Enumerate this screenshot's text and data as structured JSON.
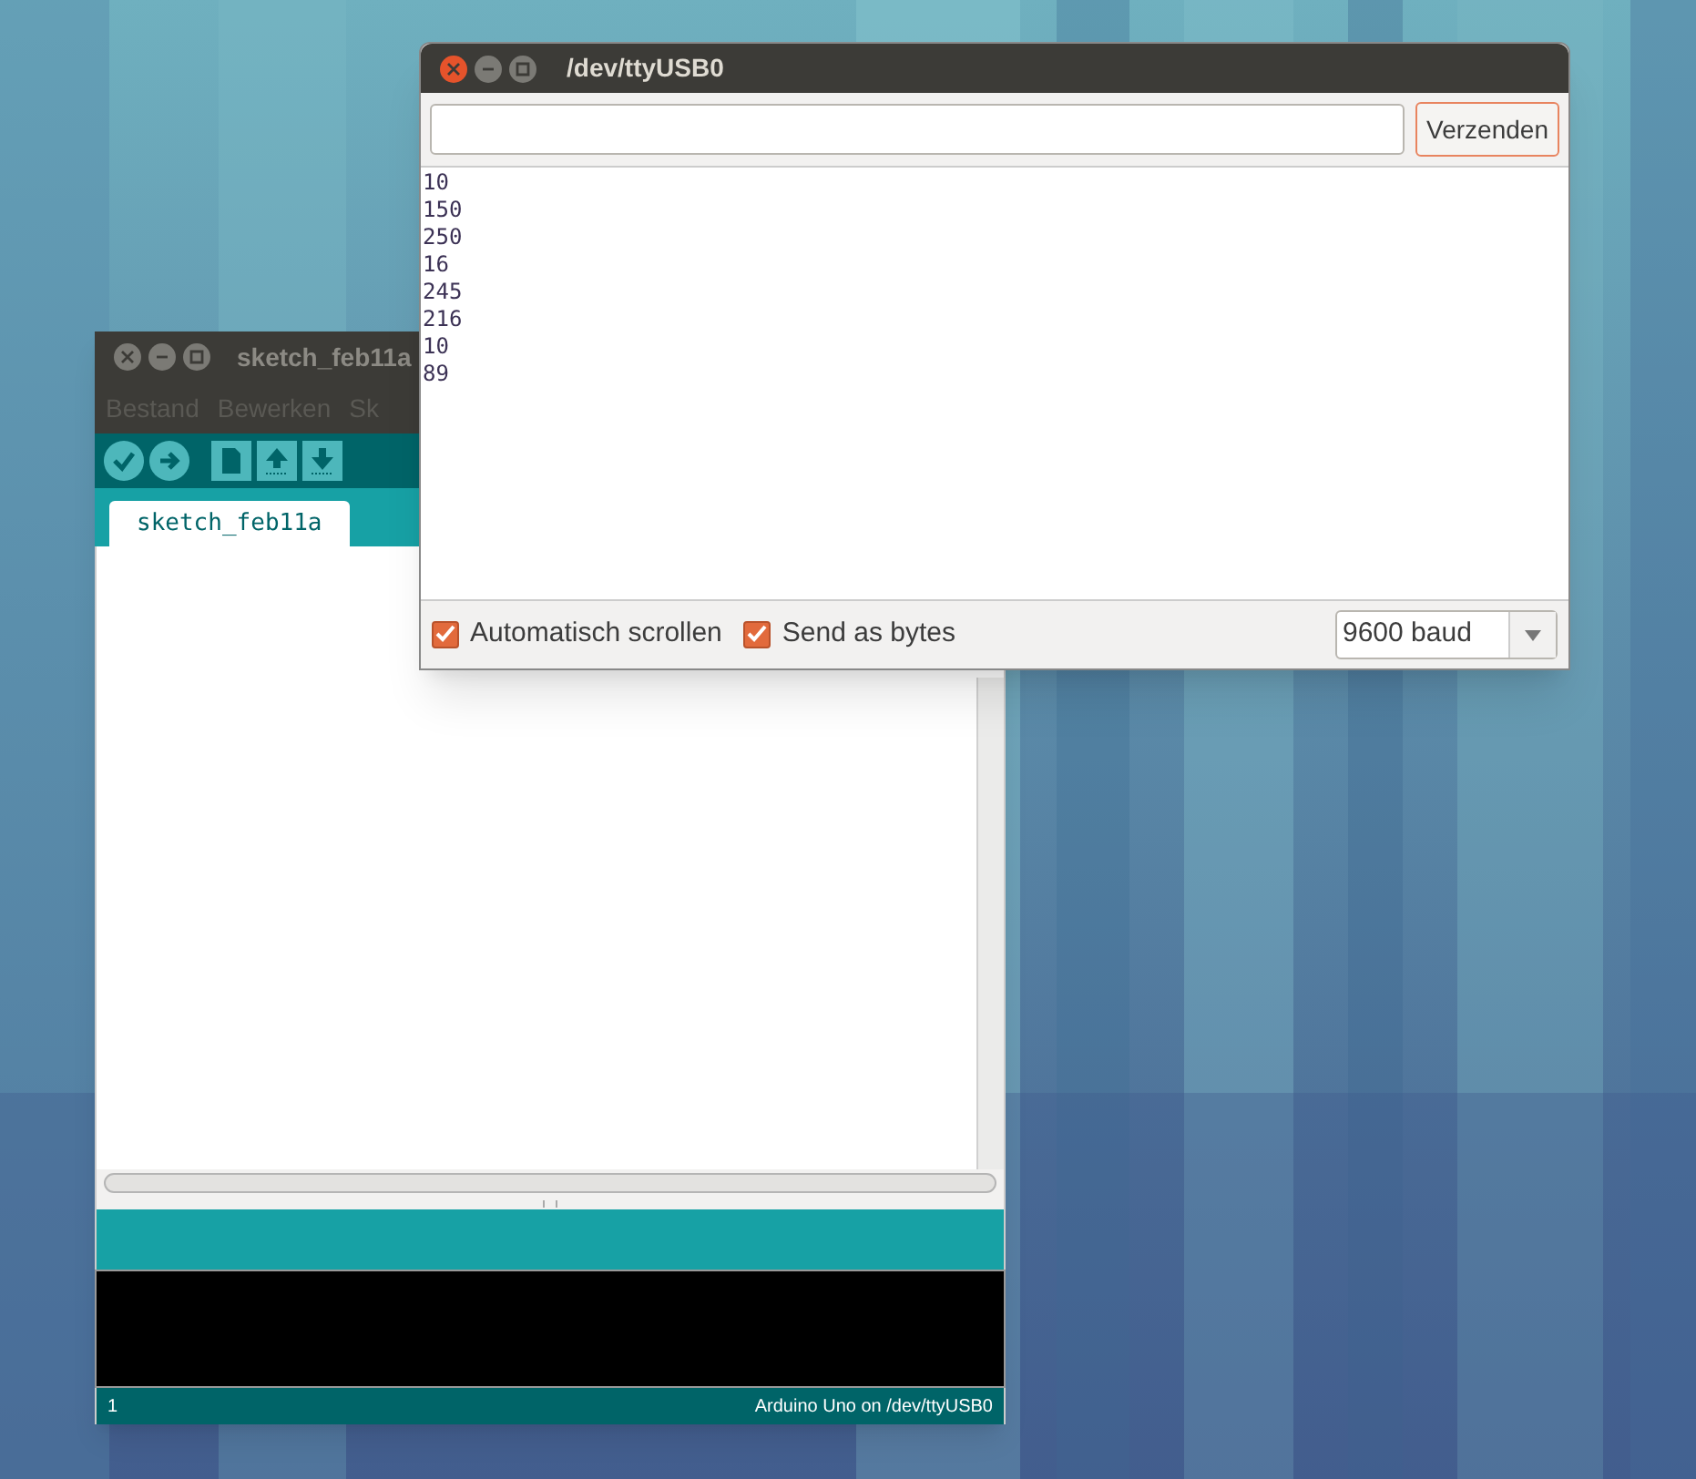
{
  "sketch_window": {
    "title": "sketch_feb11a",
    "menu": [
      "Bestand",
      "Bewerken",
      "Sk"
    ],
    "tabs": [
      {
        "label": "sketch_feb11a",
        "selected": true
      }
    ],
    "line_number": "1",
    "board": "Arduino Uno on /dev/ttyUSB0"
  },
  "serial_monitor": {
    "title": "/dev/ttyUSB0",
    "send_button": "Verzenden",
    "output_lines": [
      "10",
      "150",
      "250",
      "16",
      "245",
      "216",
      "10",
      "89"
    ],
    "options": [
      {
        "label": "Automatisch scrollen",
        "checked": true
      },
      {
        "label": "Send as bytes",
        "checked": true
      }
    ],
    "baud": "9600 baud"
  }
}
